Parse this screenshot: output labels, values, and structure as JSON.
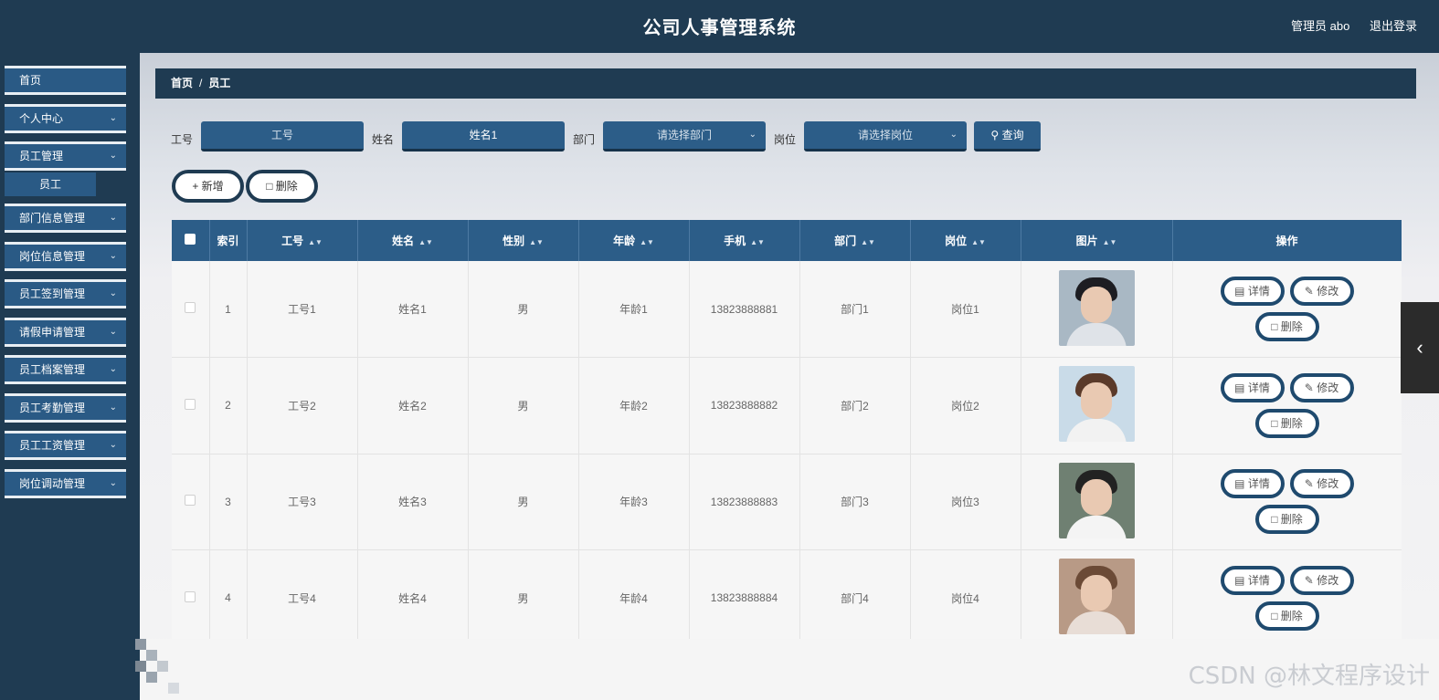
{
  "header": {
    "title": "公司人事管理系统",
    "user": "管理员 abo",
    "logout": "退出登录"
  },
  "sidebar": {
    "items": [
      {
        "label": "首页",
        "has_arrow": false
      },
      {
        "label": "个人中心",
        "has_arrow": true
      },
      {
        "label": "员工管理",
        "has_arrow": true
      },
      {
        "label": "部门信息管理",
        "has_arrow": true
      },
      {
        "label": "岗位信息管理",
        "has_arrow": true
      },
      {
        "label": "员工签到管理",
        "has_arrow": true
      },
      {
        "label": "请假申请管理",
        "has_arrow": true
      },
      {
        "label": "员工档案管理",
        "has_arrow": true
      },
      {
        "label": "员工考勤管理",
        "has_arrow": true
      },
      {
        "label": "员工工资管理",
        "has_arrow": true
      },
      {
        "label": "岗位调动管理",
        "has_arrow": true
      }
    ],
    "active_sub": "员工"
  },
  "breadcrumb": {
    "home": "首页",
    "sep": "/",
    "current": "员工"
  },
  "search": {
    "emp_no_label": "工号",
    "emp_no_placeholder": "工号",
    "name_label": "姓名",
    "name_value": "姓名1",
    "dept_label": "部门",
    "dept_placeholder": "请选择部门",
    "post_label": "岗位",
    "post_placeholder": "请选择岗位",
    "query_label": "查询"
  },
  "actions": {
    "add_label": "新增",
    "delete_label": "删除"
  },
  "table": {
    "columns": [
      "索引",
      "工号",
      "姓名",
      "性别",
      "年龄",
      "手机",
      "部门",
      "岗位",
      "图片",
      "操作"
    ],
    "rows": [
      {
        "index": "1",
        "emp_no": "工号1",
        "name": "姓名1",
        "gender": "男",
        "age": "年龄1",
        "phone": "13823888881",
        "dept": "部门1",
        "post": "岗位1"
      },
      {
        "index": "2",
        "emp_no": "工号2",
        "name": "姓名2",
        "gender": "男",
        "age": "年龄2",
        "phone": "13823888882",
        "dept": "部门2",
        "post": "岗位2"
      },
      {
        "index": "3",
        "emp_no": "工号3",
        "name": "姓名3",
        "gender": "男",
        "age": "年龄3",
        "phone": "13823888883",
        "dept": "部门3",
        "post": "岗位3"
      },
      {
        "index": "4",
        "emp_no": "工号4",
        "name": "姓名4",
        "gender": "男",
        "age": "年龄4",
        "phone": "13823888884",
        "dept": "部门4",
        "post": "岗位4"
      }
    ],
    "row_actions": {
      "detail": "详情",
      "edit": "修改",
      "delete": "删除"
    }
  },
  "colors": {
    "navy": "#1f3b52",
    "button_blue": "#2c5d88",
    "sidebar_item": "#2a5a85"
  },
  "icons": {
    "sort": "sort-icon",
    "plus": "plus-icon",
    "trash": "trash-icon",
    "search": "search-icon",
    "detail": "document-icon",
    "edit": "pencil-icon",
    "collapse": "chevron-left-icon"
  },
  "watermark": "CSDN @林文程序设计"
}
